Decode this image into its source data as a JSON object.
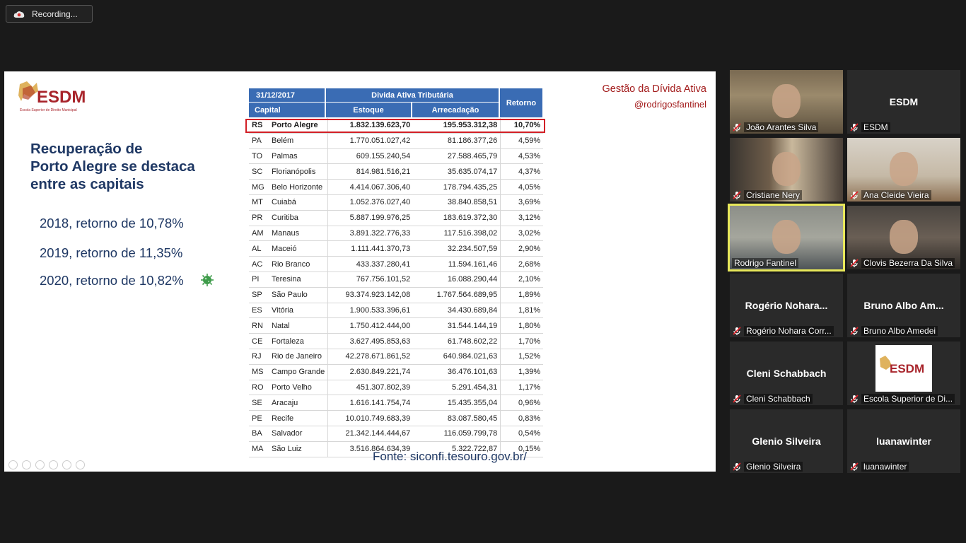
{
  "recording": {
    "label": "Recording..."
  },
  "slide": {
    "logo_text": "ESDM",
    "logo_sub": "Escola Superior de Direito Municipal",
    "title_lines": [
      "Recuperação de",
      "Porto Alegre se destaca",
      "entre as capitais"
    ],
    "bullets": [
      "2018, retorno de 10,78%",
      "2019, retorno de 11,35%",
      "2020, retorno de 10,82%"
    ],
    "top_right_title": "Gestão da Dívida Ativa",
    "top_right_handle": "@rodrigosfantinel",
    "source": "Fonte: siconfi.tesouro.gov.br/",
    "table": {
      "date": "31/12/2017",
      "group": "Divida Ativa Tributária",
      "col_capital": "Capital",
      "col_estoque": "Estoque",
      "col_arrecadacao": "Arrecadação",
      "col_retorno": "Retorno",
      "rows": [
        {
          "uf": "RS",
          "city": "Porto Alegre",
          "estoque": "1.832.139.623,70",
          "arrecadacao": "195.953.312,38",
          "retorno": "10,70%"
        },
        {
          "uf": "PA",
          "city": "Belém",
          "estoque": "1.770.051.027,42",
          "arrecadacao": "81.186.377,26",
          "retorno": "4,59%"
        },
        {
          "uf": "TO",
          "city": "Palmas",
          "estoque": "609.155.240,54",
          "arrecadacao": "27.588.465,79",
          "retorno": "4,53%"
        },
        {
          "uf": "SC",
          "city": "Florianópolis",
          "estoque": "814.981.516,21",
          "arrecadacao": "35.635.074,17",
          "retorno": "4,37%"
        },
        {
          "uf": "MG",
          "city": "Belo Horizonte",
          "estoque": "4.414.067.306,40",
          "arrecadacao": "178.794.435,25",
          "retorno": "4,05%"
        },
        {
          "uf": "MT",
          "city": "Cuiabá",
          "estoque": "1.052.376.027,40",
          "arrecadacao": "38.840.858,51",
          "retorno": "3,69%"
        },
        {
          "uf": "PR",
          "city": "Curitiba",
          "estoque": "5.887.199.976,25",
          "arrecadacao": "183.619.372,30",
          "retorno": "3,12%"
        },
        {
          "uf": "AM",
          "city": "Manaus",
          "estoque": "3.891.322.776,33",
          "arrecadacao": "117.516.398,02",
          "retorno": "3,02%"
        },
        {
          "uf": "AL",
          "city": "Maceió",
          "estoque": "1.111.441.370,73",
          "arrecadacao": "32.234.507,59",
          "retorno": "2,90%"
        },
        {
          "uf": "AC",
          "city": "Rio Branco",
          "estoque": "433.337.280,41",
          "arrecadacao": "11.594.161,46",
          "retorno": "2,68%"
        },
        {
          "uf": "PI",
          "city": "Teresina",
          "estoque": "767.756.101,52",
          "arrecadacao": "16.088.290,44",
          "retorno": "2,10%"
        },
        {
          "uf": "SP",
          "city": "São Paulo",
          "estoque": "93.374.923.142,08",
          "arrecadacao": "1.767.564.689,95",
          "retorno": "1,89%"
        },
        {
          "uf": "ES",
          "city": "Vitória",
          "estoque": "1.900.533.396,61",
          "arrecadacao": "34.430.689,84",
          "retorno": "1,81%"
        },
        {
          "uf": "RN",
          "city": "Natal",
          "estoque": "1.750.412.444,00",
          "arrecadacao": "31.544.144,19",
          "retorno": "1,80%"
        },
        {
          "uf": "CE",
          "city": "Fortaleza",
          "estoque": "3.627.495.853,63",
          "arrecadacao": "61.748.602,22",
          "retorno": "1,70%"
        },
        {
          "uf": "RJ",
          "city": "Rio de Janeiro",
          "estoque": "42.278.671.861,52",
          "arrecadacao": "640.984.021,63",
          "retorno": "1,52%"
        },
        {
          "uf": "MS",
          "city": "Campo Grande",
          "estoque": "2.630.849.221,74",
          "arrecadacao": "36.476.101,63",
          "retorno": "1,39%"
        },
        {
          "uf": "RO",
          "city": "Porto Velho",
          "estoque": "451.307.802,39",
          "arrecadacao": "5.291.454,31",
          "retorno": "1,17%"
        },
        {
          "uf": "SE",
          "city": "Aracaju",
          "estoque": "1.616.141.754,74",
          "arrecadacao": "15.435.355,04",
          "retorno": "0,96%"
        },
        {
          "uf": "PE",
          "city": "Recife",
          "estoque": "10.010.749.683,39",
          "arrecadacao": "83.087.580,45",
          "retorno": "0,83%"
        },
        {
          "uf": "BA",
          "city": "Salvador",
          "estoque": "21.342.144.444,67",
          "arrecadacao": "116.059.799,78",
          "retorno": "0,54%"
        },
        {
          "uf": "MA",
          "city": "São Luiz",
          "estoque": "3.516.864.634,39",
          "arrecadacao": "5.322.722,87",
          "retorno": "0,15%"
        }
      ]
    }
  },
  "participants": [
    {
      "name": "João Arantes Silva",
      "video": true,
      "big": ""
    },
    {
      "name": "ESDM",
      "video": false,
      "big": "ESDM"
    },
    {
      "name": "Cristiane Nery",
      "video": true,
      "big": ""
    },
    {
      "name": "Ana Cleide Vieira",
      "video": true,
      "big": ""
    },
    {
      "name": "Rodrigo Fantinel",
      "video": true,
      "big": "",
      "active": true
    },
    {
      "name": "Clovis Bezerra Da Silva",
      "video": true,
      "big": ""
    },
    {
      "name": "Rogério Nohara Corr...",
      "video": false,
      "big": "Rogério  Nohara..."
    },
    {
      "name": "Bruno Albo Amedei",
      "video": false,
      "big": "Bruno Albo Am..."
    },
    {
      "name": "Cleni Schabbach",
      "video": false,
      "big": "Cleni Schabbach"
    },
    {
      "name": "Escola Superior de Di...",
      "video": false,
      "big": "",
      "logo": true
    },
    {
      "name": "Glenio Silveira",
      "video": false,
      "big": "Glenio Silveira"
    },
    {
      "name": "luanawinter",
      "video": false,
      "big": "luanawinter"
    }
  ]
}
